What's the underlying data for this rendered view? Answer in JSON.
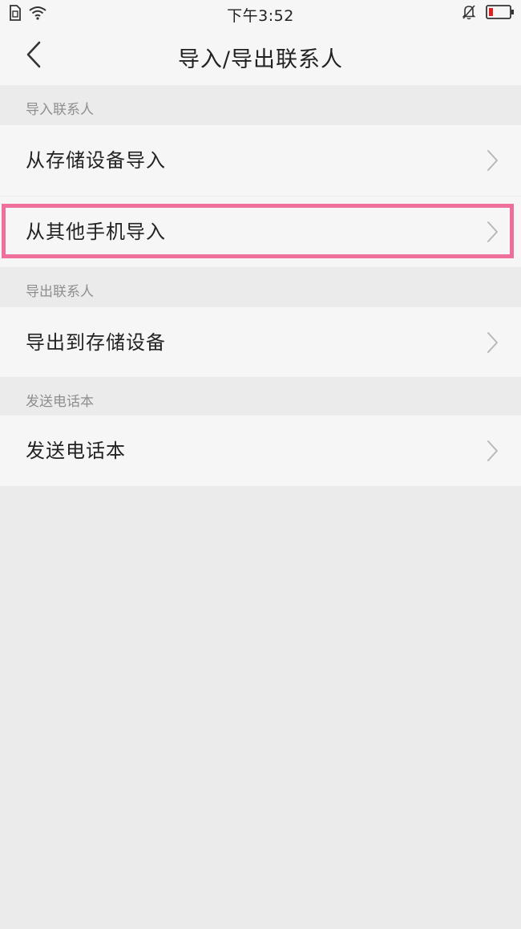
{
  "status_bar": {
    "time": "下午3:52",
    "icons": [
      "sim-card-icon",
      "wifi-icon",
      "bell-muted-icon",
      "battery-low-icon"
    ]
  },
  "header": {
    "title": "导入/导出联系人",
    "back_icon": "chevron-left-icon"
  },
  "sections": [
    {
      "label": "导入联系人",
      "items": [
        {
          "label": "从存储设备导入"
        },
        {
          "label": "从其他手机导入",
          "highlighted": true
        }
      ]
    },
    {
      "label": "导出联系人",
      "items": [
        {
          "label": "导出到存储设备"
        }
      ]
    },
    {
      "label": "发送电话本",
      "items": [
        {
          "label": "发送电话本"
        }
      ]
    }
  ],
  "colors": {
    "background": "#ebebeb",
    "row_background": "#f6f6f6",
    "highlight_border": "#ee6f9b",
    "battery_low": "#e02020",
    "section_label": "#8e8e8e"
  }
}
